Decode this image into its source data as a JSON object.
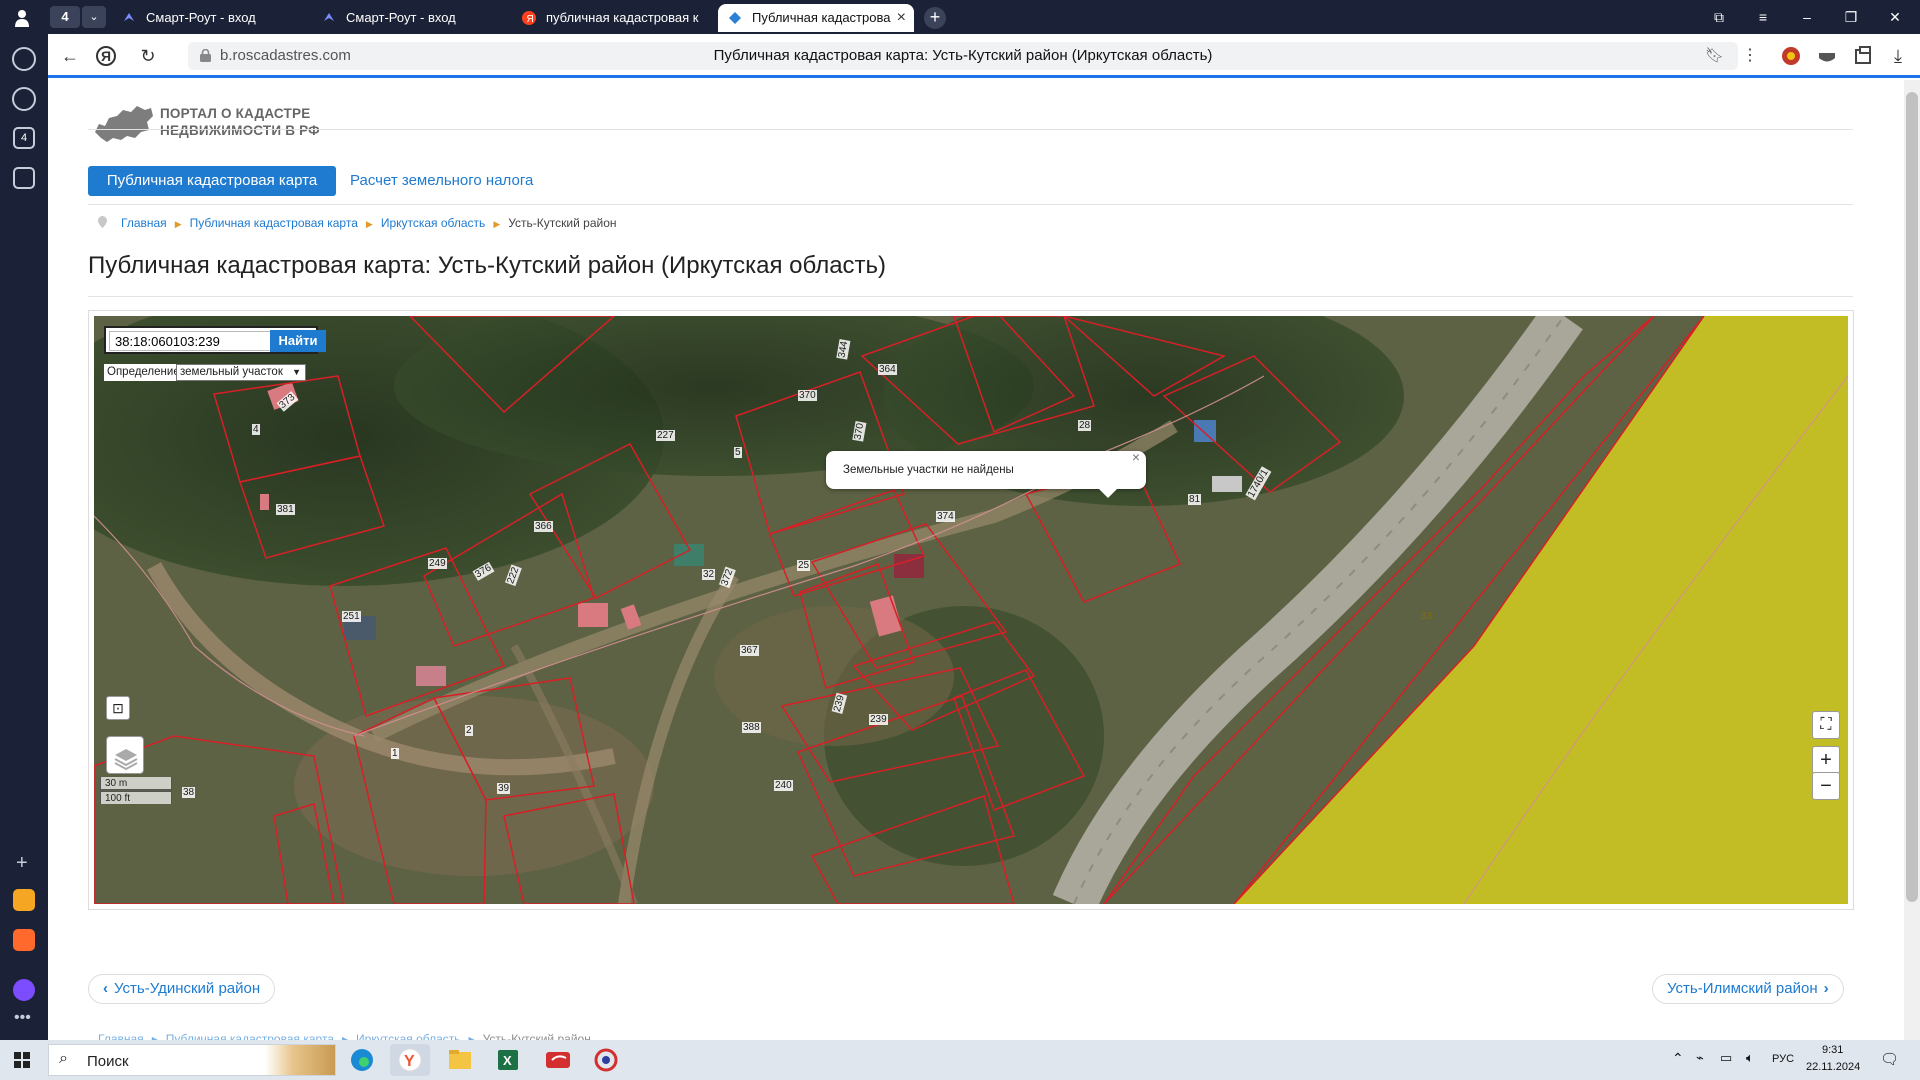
{
  "browser": {
    "tab_count": "4",
    "tabs": [
      {
        "title": "Смарт-Роут - вход"
      },
      {
        "title": "Смарт-Роут - вход"
      },
      {
        "title": "публичная кадастровая к"
      },
      {
        "title": "Публичная кадастрова"
      }
    ],
    "url_domain": "b.roscadastres.com",
    "page_title": "Публичная кадастровая карта: Усть-Кутский район (Иркутская область)"
  },
  "site": {
    "logo_line1": "ПОРТАЛ О КАДАСТРЕ",
    "logo_line2": "НЕДВИЖИМОСТИ В РФ",
    "nav_active": "Публичная кадастровая карта",
    "nav_link": "Расчет земельного налога",
    "breadcrumb": [
      "Главная",
      "Публичная кадастровая карта",
      "Иркутская область",
      "Усть-Кутский район"
    ],
    "heading": "Публичная кадастровая карта: Усть-Кутский район (Иркутская область)"
  },
  "map": {
    "search_value": "38:18:060103:239",
    "search_button": "Найти",
    "definition_label": "Определение:",
    "definition_value": "земельный участок",
    "popup_text": "Земельные участки не найдены",
    "popup_close": "×",
    "zoom_in": "+",
    "zoom_out": "−",
    "scale_metric": "30 m",
    "scale_imperial": "100 ft",
    "parcel_labels": [
      "373",
      "4",
      "381",
      "249",
      "376",
      "222",
      "366",
      "227",
      "5",
      "370",
      "344",
      "364",
      "370",
      "28",
      "374",
      "81",
      "1740/1",
      "32",
      "372",
      "25",
      "367",
      "251",
      "2",
      "1",
      "39",
      "38",
      "388",
      "239",
      "239",
      "240",
      "33"
    ]
  },
  "footer_nav": {
    "prev": "Усть-Удинский район",
    "next": "Усть-Илимский район"
  },
  "taskbar": {
    "search": "Поиск",
    "lang": "РУС",
    "time": "9:31",
    "date": "22.11.2024"
  }
}
